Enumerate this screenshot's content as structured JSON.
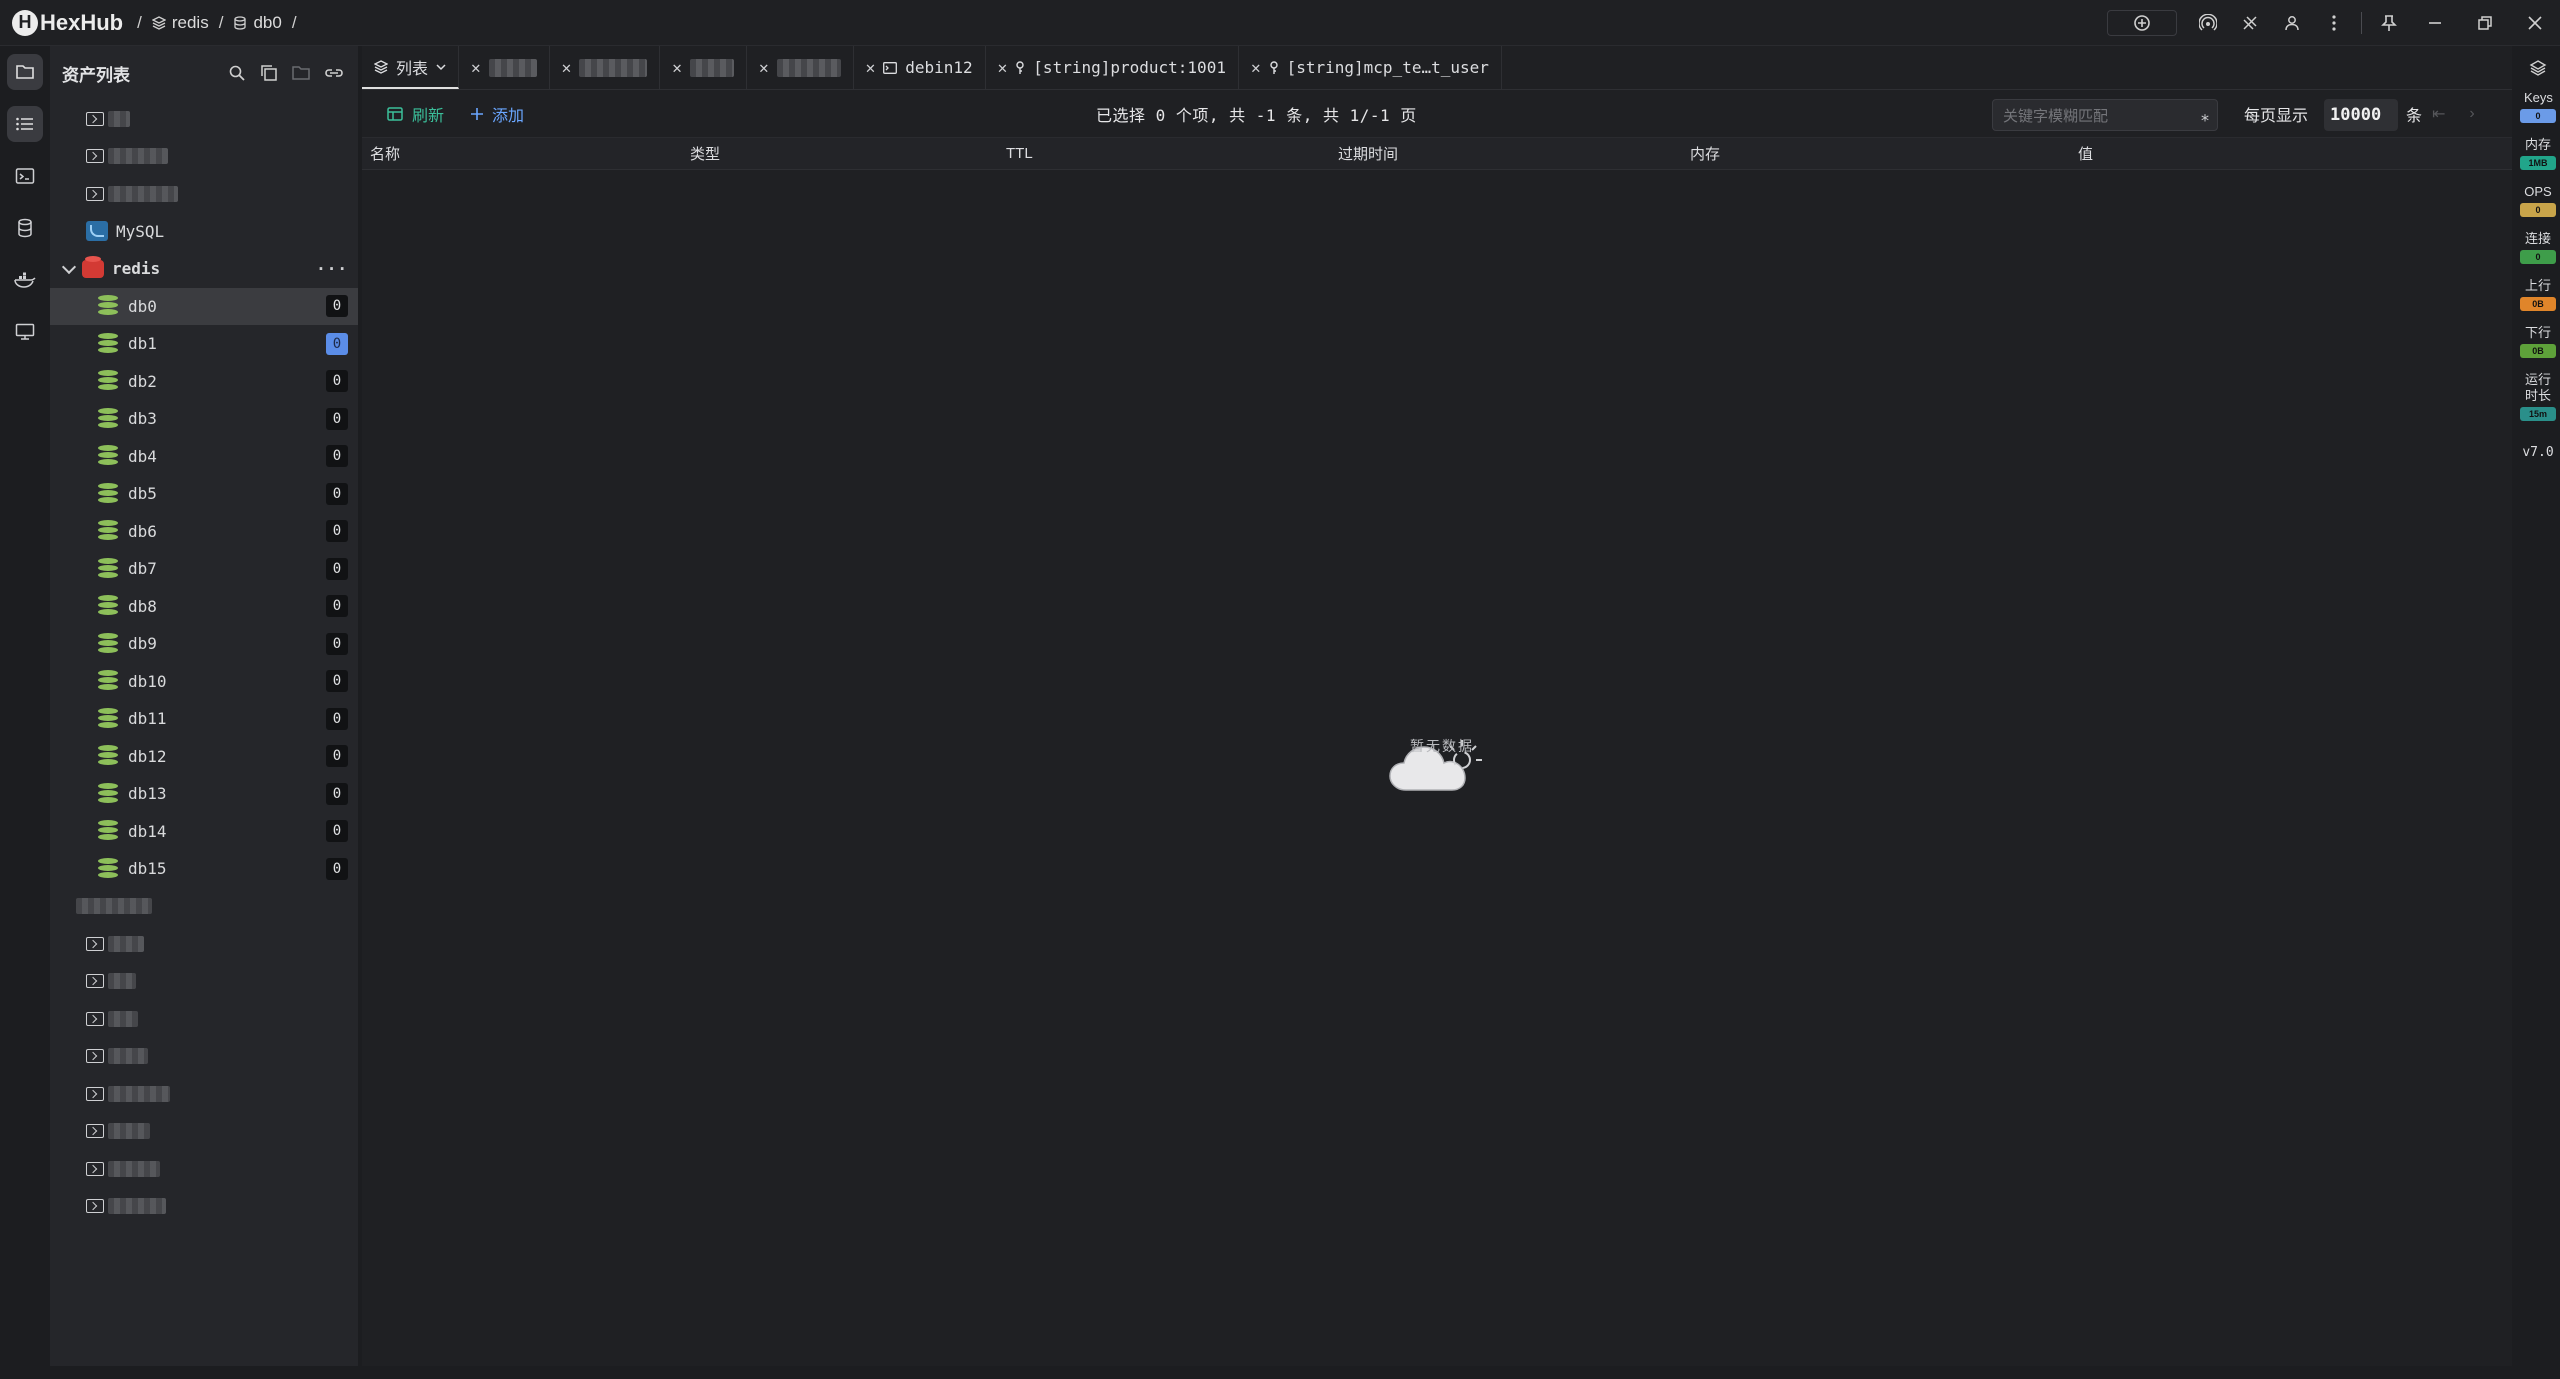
{
  "app": {
    "name": "HexHub"
  },
  "breadcrumb": [
    {
      "label": "redis"
    },
    {
      "label": "db0"
    }
  ],
  "sidebar": {
    "title": "资产列表",
    "items_top": [
      {
        "label": ""
      },
      {
        "label": ""
      },
      {
        "label": ""
      }
    ],
    "mysql": {
      "label": "MySQL"
    },
    "redis": {
      "label": "redis",
      "dbs": [
        {
          "label": "db0",
          "count": "0"
        },
        {
          "label": "db1",
          "count": "0"
        },
        {
          "label": "db2",
          "count": "0"
        },
        {
          "label": "db3",
          "count": "0"
        },
        {
          "label": "db4",
          "count": "0"
        },
        {
          "label": "db5",
          "count": "0"
        },
        {
          "label": "db6",
          "count": "0"
        },
        {
          "label": "db7",
          "count": "0"
        },
        {
          "label": "db8",
          "count": "0"
        },
        {
          "label": "db9",
          "count": "0"
        },
        {
          "label": "db10",
          "count": "0"
        },
        {
          "label": "db11",
          "count": "0"
        },
        {
          "label": "db12",
          "count": "0"
        },
        {
          "label": "db13",
          "count": "0"
        },
        {
          "label": "db14",
          "count": "0"
        },
        {
          "label": "db15",
          "count": "0"
        }
      ]
    }
  },
  "tabs": {
    "active": "列表",
    "items": [
      {
        "label": "debin12"
      },
      {
        "label": "[string]product:1001"
      },
      {
        "label": "[string]mcp_te…t_user"
      }
    ]
  },
  "toolbar": {
    "refresh": "刷新",
    "add": "添加",
    "status": "已选择 0 个项, 共 -1 条, 共 1/-1 页",
    "search_placeholder": "关键字模糊匹配",
    "page_size_label": "每页显示",
    "page_size": "10000",
    "unit": "条"
  },
  "table": {
    "columns": [
      "名称",
      "类型",
      "TTL",
      "过期时间",
      "内存",
      "值"
    ],
    "empty_text": "暂无数据"
  },
  "stats": [
    {
      "label": "Keys",
      "value": "0",
      "color": "#6b9be8"
    },
    {
      "label": "内存",
      "value": "1MB",
      "color": "#21a58a"
    },
    {
      "label": "OPS",
      "value": "0",
      "color": "#c8a44a"
    },
    {
      "label": "连接",
      "value": "0",
      "color": "#3e9d4a"
    },
    {
      "label": "上行",
      "value": "0B",
      "color": "#e0852a"
    },
    {
      "label": "下行",
      "value": "0B",
      "color": "#5ea13a"
    },
    {
      "label": "运行时长",
      "value": "15m",
      "color": "#2a8f8a"
    }
  ],
  "version": "v7.0"
}
